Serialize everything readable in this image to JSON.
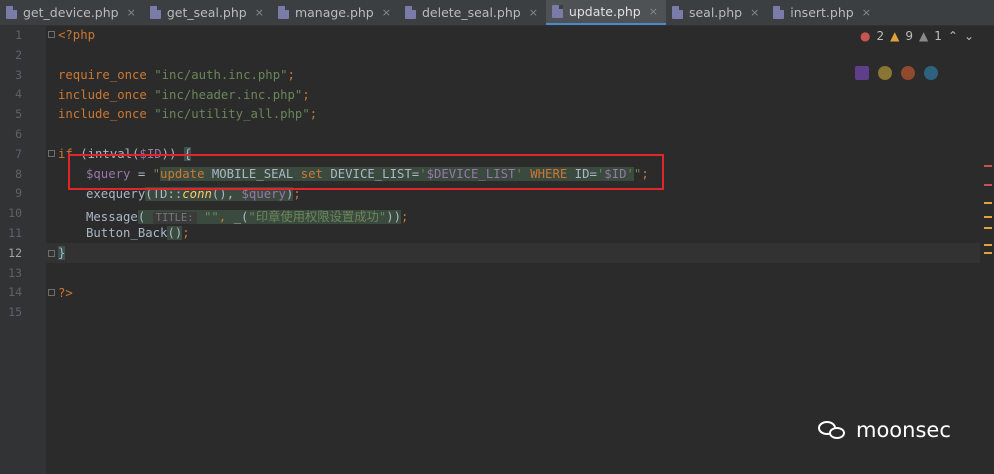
{
  "tabs": [
    {
      "label": "get_device.php",
      "active": false
    },
    {
      "label": "get_seal.php",
      "active": false
    },
    {
      "label": "manage.php",
      "active": false
    },
    {
      "label": "delete_seal.php",
      "active": false
    },
    {
      "label": "update.php",
      "active": true
    },
    {
      "label": "seal.php",
      "active": false
    },
    {
      "label": "insert.php",
      "active": false
    }
  ],
  "tab_close_glyph": "×",
  "line_numbers": [
    "1",
    "2",
    "3",
    "4",
    "5",
    "6",
    "7",
    "8",
    "9",
    "10",
    "11",
    "12",
    "13",
    "14",
    "15"
  ],
  "current_line": "12",
  "code": {
    "l1": "<?php",
    "l3_kw": "require_once",
    "l3_str": "\"inc/auth.inc.php\"",
    "l4_kw": "include_once",
    "l4_str": "\"inc/header.inc.php\"",
    "l5_kw": "include_once",
    "l5_str": "\"inc/utility_all.php\"",
    "l7_if": "if",
    "l7_fn": "intval",
    "l7_var": "$ID",
    "l8_var": "$query",
    "l8_sql1": "update",
    "l8_sql2": " MOBILE_SEAL ",
    "l8_sql3": "set",
    "l8_sql4": " DEVICE_LIST=",
    "l8_var2": "$DEVICE_LIST",
    "l8_sql5": " WHERE",
    "l8_sql6": " ID=",
    "l8_var3": "$ID",
    "l9_fn": "exequery",
    "l9_cls": "TD",
    "l9_m": "conn",
    "l9_var": "$query",
    "l10_fn": "Message",
    "l10_hint": "TITLE:",
    "l10_str": "\"印章使用权限设置成功\"",
    "l11_fn": "Button_Back",
    "l14": "?>"
  },
  "inspections": {
    "errors": "2",
    "warnings": "9",
    "weak": "1"
  },
  "browser_icons": [
    "phpstorm-icon",
    "chrome-icon",
    "firefox-icon",
    "edge-icon"
  ],
  "watermark": "moonsec"
}
